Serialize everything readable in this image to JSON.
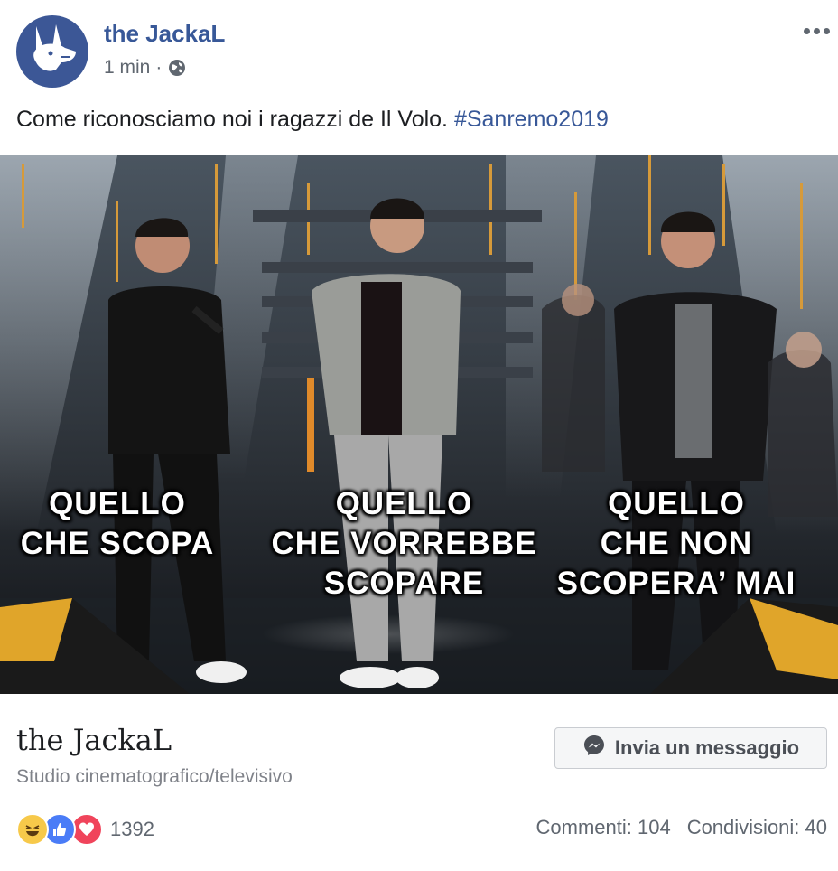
{
  "post": {
    "author": "the JackaL",
    "time": "1 min",
    "separator": "·",
    "privacy_icon": "globe-icon",
    "menu_icon": "more-dots-icon",
    "text": "Come riconosciamo noi i ragazzi de Il Volo. ",
    "hashtag": "#Sanremo2019"
  },
  "media": {
    "captions": [
      {
        "line1": "QUELLO",
        "line2": "CHE SCOPA",
        "line3": ""
      },
      {
        "line1": "QUELLO",
        "line2": "CHE VORREBBE",
        "line3": "SCOPARE"
      },
      {
        "line1": "QUELLO",
        "line2": "CHE NON",
        "line3": "SCOPERA’ MAI"
      }
    ]
  },
  "footer": {
    "page_name": "the JackaL",
    "category": "Studio cinematografico/televisivo",
    "message_button": "Invia un messaggio",
    "reaction_count": "1392",
    "comments": "Commenti: 104",
    "shares": "Condivisioni: 40"
  },
  "colors": {
    "brand_blue": "#385898",
    "avatar_bg": "#3c5796",
    "like_blue": "#4a7cf7",
    "love_red": "#f0445b",
    "haha_yellow": "#f7c94a"
  }
}
